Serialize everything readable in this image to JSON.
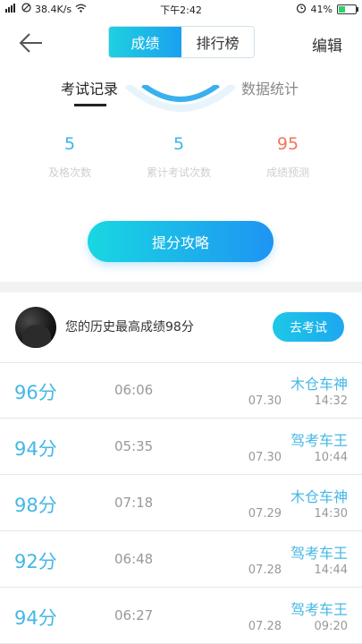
{
  "status_bar": {
    "left_text": "38.4K/s",
    "time": "下午2:42",
    "battery": "41%",
    "battery_level": 0.41
  },
  "header": {
    "tabs": [
      {
        "label": "成绩",
        "active": true
      },
      {
        "label": "排行榜",
        "active": false
      }
    ],
    "edit_label": "编辑"
  },
  "subtabs": [
    {
      "label": "考试记录",
      "active": true
    },
    {
      "label": "数据统计",
      "active": false
    }
  ],
  "stats": [
    {
      "value": "5",
      "label": "及格次数"
    },
    {
      "value": "5",
      "label": "累计考试次数"
    },
    {
      "value": "95",
      "label": "成绩预测"
    }
  ],
  "cta_label": "提分攻略",
  "best": {
    "text": "您的历史最高成绩98分",
    "button_label": "去考试"
  },
  "records": [
    {
      "score": "96分",
      "duration": "06:06",
      "title": "木仓车神",
      "date": "07.30",
      "time": "14:32"
    },
    {
      "score": "94分",
      "duration": "05:35",
      "title": "驾考车王",
      "date": "07.30",
      "time": "10:44"
    },
    {
      "score": "98分",
      "duration": "07:18",
      "title": "木仓车神",
      "date": "07.29",
      "time": "14:30"
    },
    {
      "score": "92分",
      "duration": "06:48",
      "title": "驾考车王",
      "date": "07.28",
      "time": "14:44"
    },
    {
      "score": "94分",
      "duration": "06:27",
      "title": "驾考车王",
      "date": "07.28",
      "time": "09:20"
    }
  ],
  "colors": {
    "accent": "#1aa0f0",
    "accent_light": "#1fd0df",
    "score": "#45b7e6",
    "prediction": "#f2765c"
  }
}
